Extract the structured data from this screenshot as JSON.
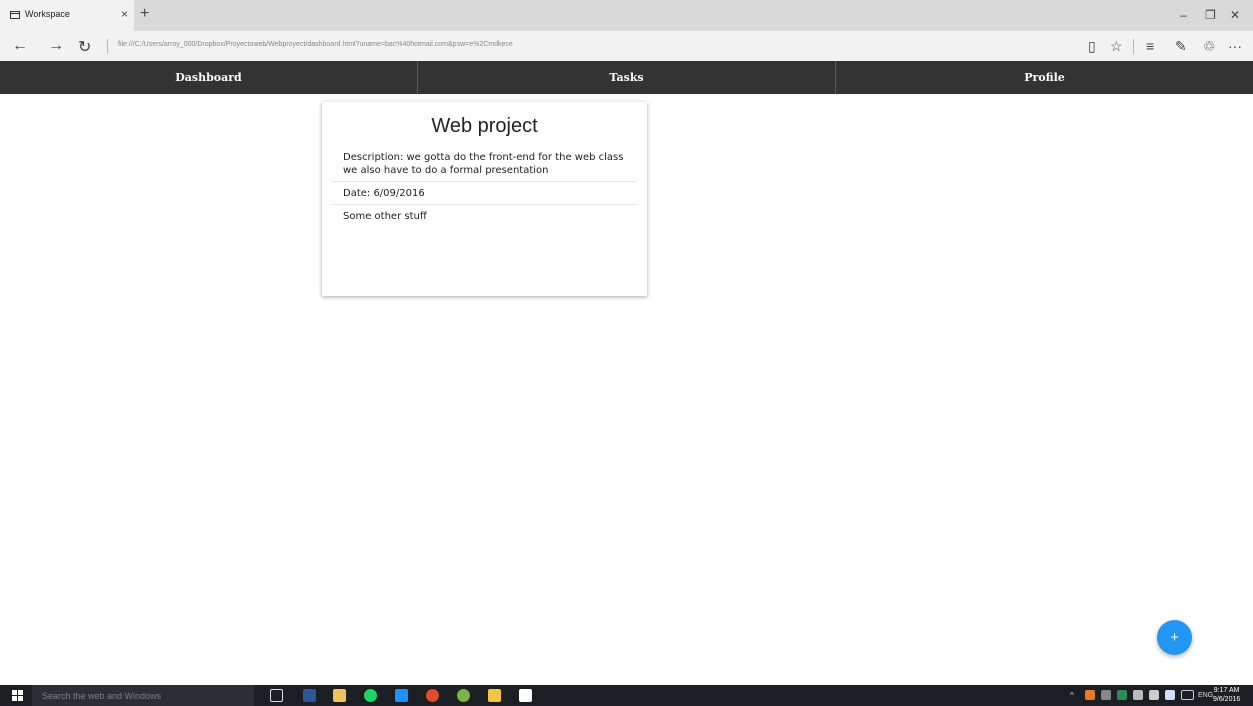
{
  "browser": {
    "tab_title": "Workspace",
    "tab_close": "×",
    "new_tab": "+",
    "url": "file:///C:/Users/arroy_000/Dropbox/Proyectoweb/Webproyect/dashboard.html?uname=bac%40hotmail.com&psw=e%2Cmdkece",
    "window_controls": {
      "minimize": "–",
      "maximize": "❐",
      "close": "✕"
    },
    "nav": {
      "back": "←",
      "forward": "→",
      "refresh": "↻"
    },
    "tools": {
      "reading_view": "▯",
      "favorite": "☆",
      "hub": "≡",
      "note": "✎",
      "share": "♲",
      "more": "···"
    }
  },
  "navbar": {
    "items": [
      {
        "label": "Dashboard"
      },
      {
        "label": "Tasks"
      },
      {
        "label": "Profile"
      }
    ]
  },
  "card": {
    "title": "Web project",
    "description": "Description: we gotta do the front-end for the web class we also have to do a formal presentation",
    "date": "Date: 6/09/2016",
    "other": "Some other stuff"
  },
  "fab": {
    "label": "+"
  },
  "taskbar": {
    "search_placeholder": "Search the web and Windows",
    "language": "ENG",
    "time": "9:17 AM",
    "date": "9/6/2016",
    "icons": [
      {
        "name": "task-view-icon",
        "color": "#1b1f24"
      },
      {
        "name": "word-icon",
        "color": "#2b5797"
      },
      {
        "name": "file-explorer-icon",
        "color": "#f0c05a"
      },
      {
        "name": "spotify-icon",
        "color": "#1ed760"
      },
      {
        "name": "edge-icon",
        "color": "#1e90ff"
      },
      {
        "name": "chrome-icon",
        "color": "#e34c26"
      },
      {
        "name": "android-studio-icon",
        "color": "#7cb342"
      },
      {
        "name": "folder-icon",
        "color": "#f5c542"
      },
      {
        "name": "mail-icon",
        "color": "#ffffff"
      }
    ]
  }
}
